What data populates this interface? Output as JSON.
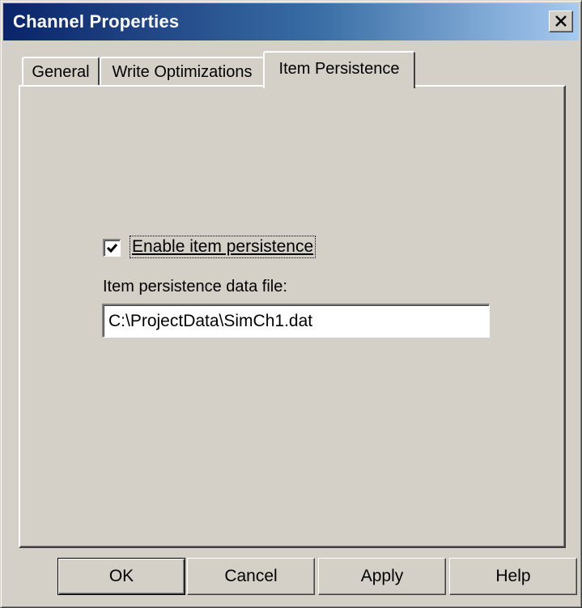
{
  "window": {
    "title": "Channel Properties",
    "close_glyph": "✕"
  },
  "tabs": [
    {
      "label": "General",
      "active": false
    },
    {
      "label": "Write Optimizations",
      "active": false
    },
    {
      "label": "Item Persistence",
      "active": true
    }
  ],
  "persistence": {
    "enable_label": "Enable item persistence",
    "enable_checked": true,
    "file_label": "Item persistence data file:",
    "file_value": "C:\\ProjectData\\SimCh1.dat"
  },
  "buttons": {
    "ok": "OK",
    "cancel": "Cancel",
    "apply": "Apply",
    "help": "Help"
  },
  "colors": {
    "titlebar_start": "#0a246a",
    "titlebar_end": "#a6caf0",
    "face": "#d4d0c8"
  }
}
